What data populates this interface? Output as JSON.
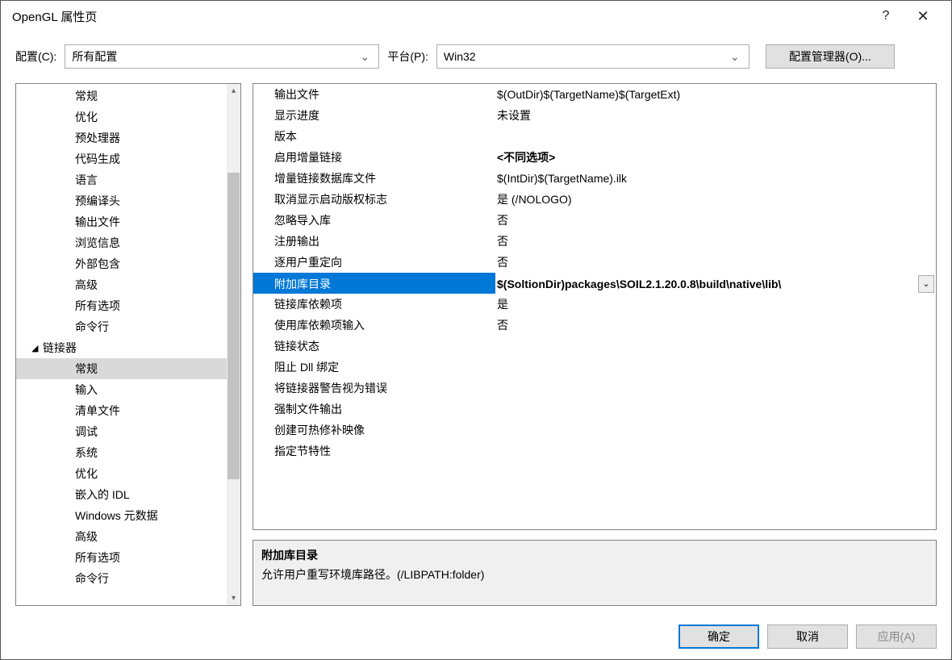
{
  "window": {
    "title": "OpenGL 属性页"
  },
  "configRow": {
    "configLabel": "配置(C):",
    "configValue": "所有配置",
    "platformLabel": "平台(P):",
    "platformValue": "Win32",
    "configMgrBtn": "配置管理器(O)..."
  },
  "tree": [
    {
      "label": "常规",
      "level": 1
    },
    {
      "label": "优化",
      "level": 1
    },
    {
      "label": "预处理器",
      "level": 1
    },
    {
      "label": "代码生成",
      "level": 1
    },
    {
      "label": "语言",
      "level": 1
    },
    {
      "label": "预编译头",
      "level": 1
    },
    {
      "label": "输出文件",
      "level": 1
    },
    {
      "label": "浏览信息",
      "level": 1
    },
    {
      "label": "外部包含",
      "level": 1
    },
    {
      "label": "高级",
      "level": 1
    },
    {
      "label": "所有选项",
      "level": 1
    },
    {
      "label": "命令行",
      "level": 1
    },
    {
      "label": "链接器",
      "level": 0,
      "expanded": true
    },
    {
      "label": "常规",
      "level": 1,
      "selected": true
    },
    {
      "label": "输入",
      "level": 1
    },
    {
      "label": "清单文件",
      "level": 1
    },
    {
      "label": "调试",
      "level": 1
    },
    {
      "label": "系统",
      "level": 1
    },
    {
      "label": "优化",
      "level": 1
    },
    {
      "label": "嵌入的 IDL",
      "level": 1
    },
    {
      "label": "Windows 元数据",
      "level": 1
    },
    {
      "label": "高级",
      "level": 1
    },
    {
      "label": "所有选项",
      "level": 1
    },
    {
      "label": "命令行",
      "level": 1
    }
  ],
  "grid": [
    {
      "name": "输出文件",
      "value": "$(OutDir)$(TargetName)$(TargetExt)"
    },
    {
      "name": "显示进度",
      "value": "未设置"
    },
    {
      "name": "版本",
      "value": ""
    },
    {
      "name": "启用增量链接",
      "value": "<不同选项>",
      "bold": true
    },
    {
      "name": "增量链接数据库文件",
      "value": "$(IntDir)$(TargetName).ilk"
    },
    {
      "name": "取消显示启动版权标志",
      "value": "是 (/NOLOGO)"
    },
    {
      "name": "忽略导入库",
      "value": "否"
    },
    {
      "name": "注册输出",
      "value": "否"
    },
    {
      "name": "逐用户重定向",
      "value": "否"
    },
    {
      "name": "附加库目录",
      "value": "$(SoltionDir)packages\\SOIL2.1.20.0.8\\build\\native\\lib\\",
      "selected": true,
      "bold": true,
      "dropdown": true
    },
    {
      "name": "链接库依赖项",
      "value": "是"
    },
    {
      "name": "使用库依赖项输入",
      "value": "否"
    },
    {
      "name": "链接状态",
      "value": ""
    },
    {
      "name": "阻止 Dll 绑定",
      "value": ""
    },
    {
      "name": "将链接器警告视为错误",
      "value": ""
    },
    {
      "name": "强制文件输出",
      "value": ""
    },
    {
      "name": "创建可热修补映像",
      "value": ""
    },
    {
      "name": "指定节特性",
      "value": ""
    }
  ],
  "desc": {
    "title": "附加库目录",
    "text": "允许用户重写环境库路径。(/LIBPATH:folder)"
  },
  "footer": {
    "ok": "确定",
    "cancel": "取消",
    "apply": "应用(A)"
  }
}
